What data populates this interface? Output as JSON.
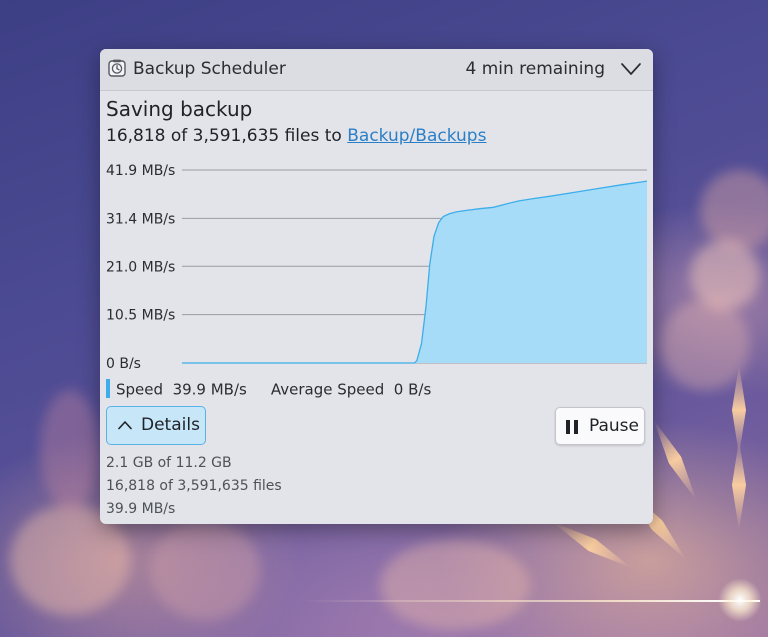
{
  "notification": {
    "app_name": "Backup Scheduler",
    "time_remaining": "4 min remaining",
    "title": "Saving backup",
    "progress_prefix": "16,818 of 3,591,635 files to ",
    "destination_link": "Backup/Backups",
    "legend": {
      "speed_label": "Speed",
      "speed_value": "39.9 MB/s",
      "avg_label": "Average Speed",
      "avg_value": "0 B/s"
    },
    "buttons": {
      "details_label": "Details",
      "pause_label": "Pause"
    },
    "details": {
      "size_progress": "2.1 GB of 11.2 GB",
      "files_progress": "16,818 of 3,591,635 files",
      "speed": "39.9 MB/s"
    }
  },
  "chart_data": {
    "type": "area",
    "y_tick_labels": [
      "41.9 MB/s",
      "31.4 MB/s",
      "21.0 MB/s",
      "10.5 MB/s",
      "0 B/s"
    ],
    "y_tick_values": [
      41.9,
      31.4,
      21.0,
      10.5,
      0
    ],
    "ylim": [
      0,
      41.9
    ],
    "xlim": [
      0,
      100
    ],
    "grid": true,
    "fill_color": "#a6dcf7",
    "line_color": "#3daee9",
    "series": [
      {
        "x": [
          0,
          50,
          50.5,
          51.5,
          52.5,
          53.3,
          54.2,
          55.2,
          56.2,
          57.5,
          59,
          61,
          64,
          67,
          70,
          72.5,
          75,
          79,
          84,
          89,
          94,
          100
        ],
        "y": [
          0,
          0,
          0.5,
          4.2,
          12.5,
          21.5,
          27.5,
          30.5,
          31.8,
          32.4,
          32.8,
          33.1,
          33.5,
          33.8,
          34.6,
          35.2,
          35.6,
          36.2,
          37.0,
          37.8,
          38.6,
          39.5
        ]
      }
    ]
  },
  "colors": {
    "accent": "#3daee9",
    "panel_bg": "#e3e3ea",
    "link": "#2a7fc7"
  },
  "icons": {
    "app": "backup-scheduler-icon",
    "expand": "chevron-down-icon",
    "details": "chevron-up-icon",
    "pause": "pause-icon"
  }
}
